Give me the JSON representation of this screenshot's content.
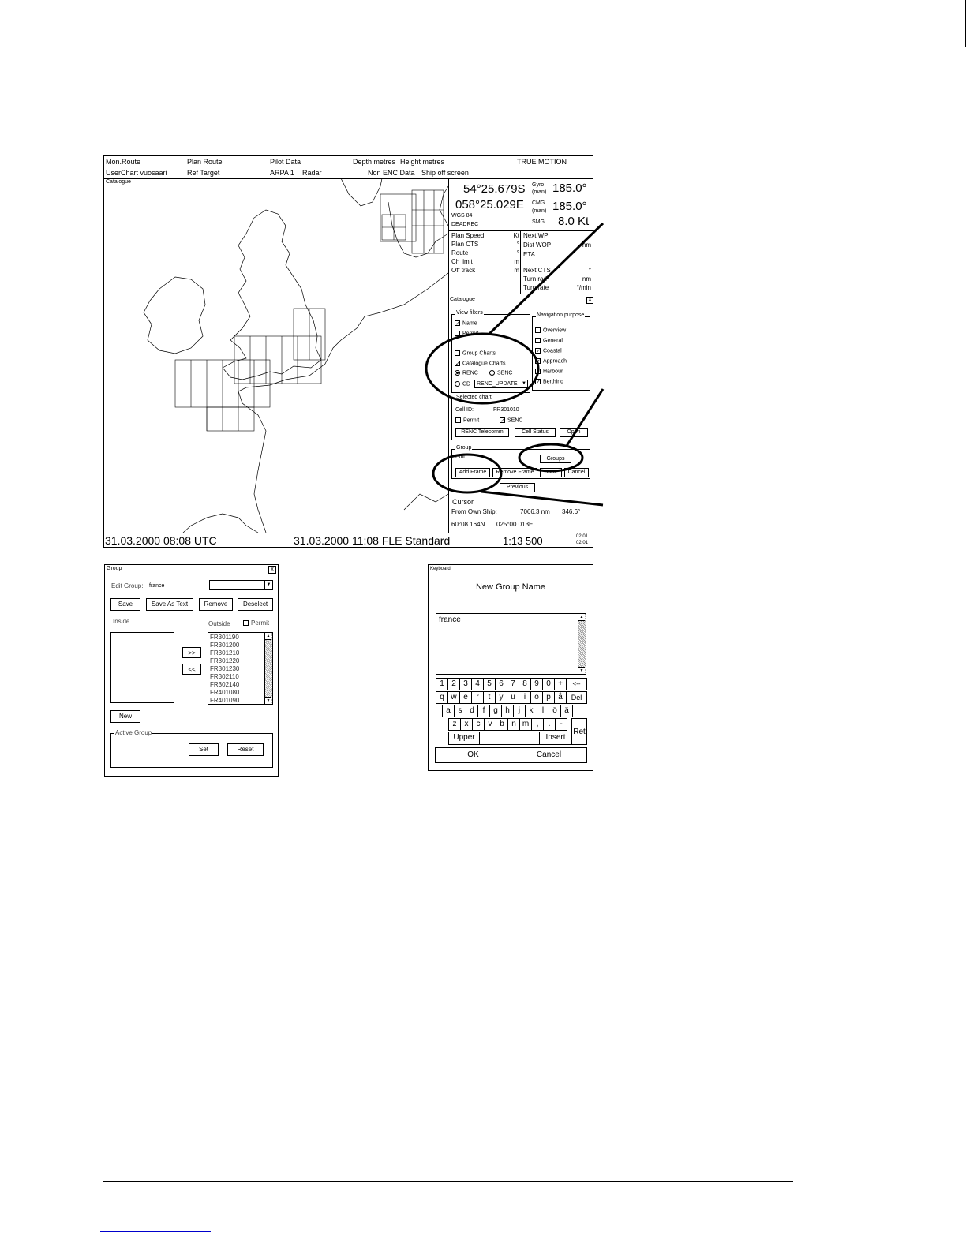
{
  "topbar": {
    "row1": [
      "Mon.Route",
      "Plan Route",
      "Pilot Data",
      "Depth metres",
      "Height metres",
      "TRUE MOTION"
    ],
    "row2": [
      "UserChart  vuosaari",
      "Ref Target",
      "ARPA 1",
      "Radar",
      "Non ENC Data",
      "Ship off screen"
    ]
  },
  "map": {
    "label": "Catalogue"
  },
  "nav": {
    "lat": "54°25.679S",
    "lon": "058°25.029E",
    "datum": "WGS 84",
    "mode": "DEADREC",
    "gyro_label": "Gyro",
    "gyro_sub": "(man)",
    "gyro_value": "185.0°",
    "cmg_label": "CMG",
    "cmg_sub": "(man)",
    "cmg_value": "185.0°",
    "smg_label": "SMG",
    "smg_value": "8.0 Kt"
  },
  "route_info": {
    "left": [
      {
        "label": "Plan Speed",
        "unit": "Kt"
      },
      {
        "label": "Plan CTS",
        "unit": "°"
      },
      {
        "label": "Route",
        "unit": "°"
      },
      {
        "label": "Ch limit",
        "unit": "m"
      },
      {
        "label": "Off track",
        "unit": "m"
      }
    ],
    "right": [
      {
        "label": "Next WP",
        "unit": ""
      },
      {
        "label": "Dist WOP",
        "unit": "nm"
      },
      {
        "label": "ETA",
        "unit": ""
      },
      {
        "label": "Next CTS",
        "unit": "°"
      },
      {
        "label": "Turn rad",
        "unit": "nm"
      },
      {
        "label": "Turn rate",
        "unit": "°/min"
      }
    ]
  },
  "catalogue": {
    "title": "Catalogue",
    "close": "x",
    "view_filters": "View filters",
    "name": "Name",
    "permit": "Permit",
    "group_charts": "Group Charts",
    "catalogue_charts": "Catalogue Charts",
    "renc": "RENC",
    "senc": "SENC",
    "cd": "CD",
    "cd_select": "RENC_UPDATE",
    "nav_purpose": "Navigation purpose",
    "purposes": [
      "Overview",
      "General",
      "Coastal",
      "Approach",
      "Harbour",
      "Berthing"
    ],
    "selected_chart": "Selected chart",
    "cell_id_label": "Cell ID:",
    "cell_id": "FR301010",
    "permit2": "Permit",
    "senc2": "SENC",
    "renc_telecomm": "RENC Telecomm",
    "cell_status": "Cell Status",
    "open": "Open",
    "group": "Group",
    "edit": "Edit",
    "groups": "Groups",
    "add_frame": "Add Frame",
    "remove_frame": "Remove Frame",
    "done": "Done",
    "cancel": "Cancel",
    "previous": "Previous"
  },
  "cursor": {
    "title": "Cursor",
    "from_label": "From Own Ship:",
    "distance": "7066.3 nm",
    "bearing": "346.6°",
    "lat": "60°08.164N",
    "lon": "025°00.013E"
  },
  "status": {
    "time1": "31.03.2000 08:08 UTC",
    "time2": "31.03.2000 11:08 FLE Standard",
    "scale": "1:13 500",
    "code1": "02.01",
    "code2": "02.01"
  },
  "group_dialog": {
    "title": "Group",
    "close": "x",
    "edit_group_label": "Edit Group:",
    "edit_group_value": "france",
    "save": "Save",
    "save_as_text": "Save As Text",
    "remove": "Remove",
    "deselect": "Deselect",
    "inside": "Inside",
    "outside": "Outside",
    "permit": "Permit",
    "outside_items": [
      "FR301190",
      "FR301200",
      "FR301210",
      "FR301220",
      "FR301230",
      "FR302110",
      "FR302140",
      "FR401080",
      "FR401090"
    ],
    "move_right": ">>",
    "move_left": "<<",
    "new": "New",
    "active_group": "Active Group",
    "set": "Set",
    "reset": "Reset"
  },
  "keyboard": {
    "title": "Keyboard",
    "heading": "New Group Name",
    "text": "france",
    "row1": [
      "1",
      "2",
      "3",
      "4",
      "5",
      "6",
      "7",
      "8",
      "9",
      "0",
      "+",
      "<--"
    ],
    "row2": [
      "q",
      "w",
      "e",
      "r",
      "t",
      "y",
      "u",
      "i",
      "o",
      "p",
      "å",
      "Del"
    ],
    "row3": [
      "a",
      "s",
      "d",
      "f",
      "g",
      "h",
      "j",
      "k",
      "l",
      "ö",
      "ä"
    ],
    "row4": [
      "z",
      "x",
      "c",
      "v",
      "b",
      "n",
      "m",
      ",",
      ".",
      "-"
    ],
    "upper": "Upper",
    "insert": "Insert",
    "ret": "Ret",
    "ok": "OK",
    "cancel": "Cancel"
  }
}
